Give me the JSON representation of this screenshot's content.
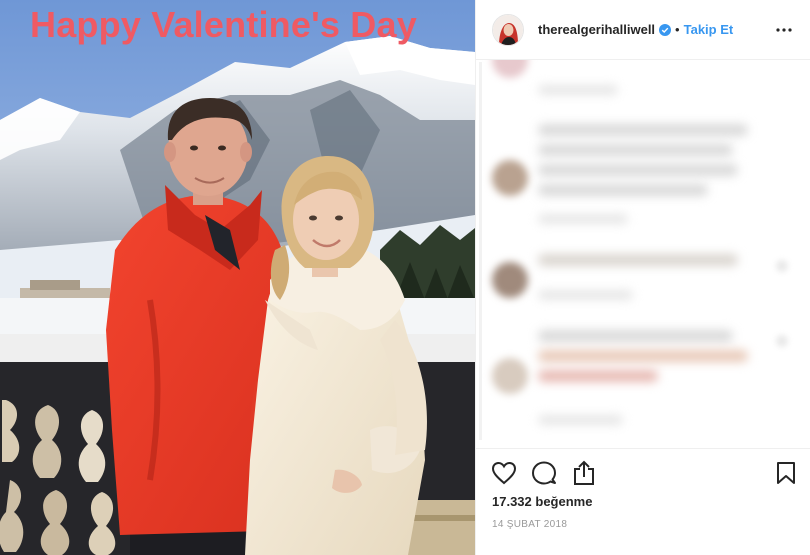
{
  "photo": {
    "overlay_text": "Happy Valentine's Day",
    "overlay_color": "#ef5a63"
  },
  "header": {
    "username": "therealgerihalliwell",
    "verified_icon": "verified-badge-icon",
    "separator": "•",
    "follow_label": "Takip Et",
    "more_icon": "more-options-icon"
  },
  "actions": {
    "like_icon": "heart-icon",
    "comment_icon": "comment-bubble-icon",
    "share_icon": "share-icon",
    "save_icon": "bookmark-icon"
  },
  "likes_text": "17.332 beğenme",
  "date_text": "14 ŞUBAT 2018",
  "colors": {
    "link_blue": "#3897f0",
    "text_dark": "#262626",
    "text_muted": "#999999",
    "border": "#efefef"
  }
}
